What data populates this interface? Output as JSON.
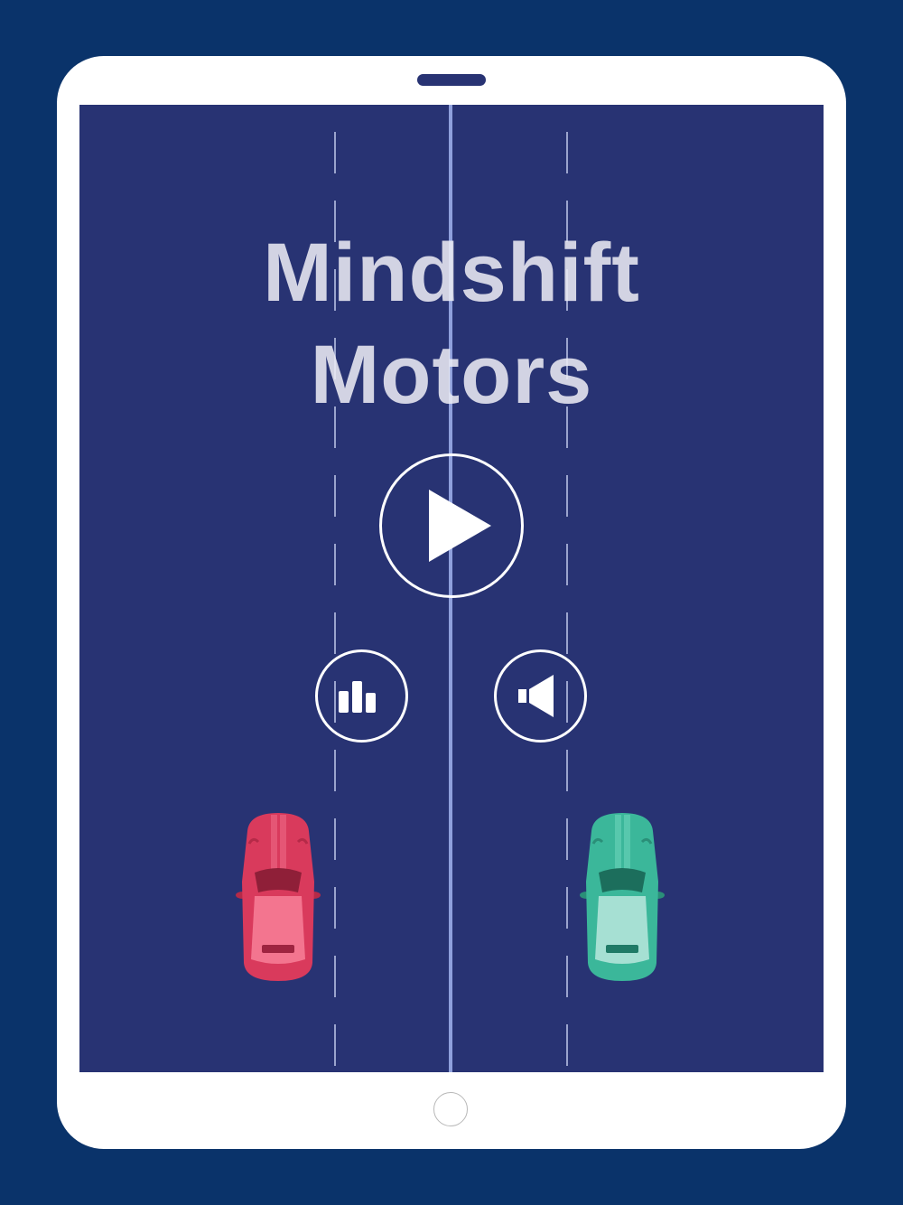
{
  "title": {
    "line1": "Mindshift",
    "line2": "Motors"
  },
  "controls": {
    "play_icon": "play-icon",
    "stats_icon": "bar-chart-icon",
    "sound_icon": "speaker-icon"
  },
  "cars": [
    {
      "name": "red-car",
      "color": "#d93a5c"
    },
    {
      "name": "green-car",
      "color": "#3bb79a"
    }
  ],
  "colors": {
    "background": "#0a336a",
    "road": "#283373",
    "tablet": "#ffffff",
    "speaker": "#283373",
    "lane_center": "#8fa0dc",
    "lane_dash": "#b8c0e4"
  }
}
